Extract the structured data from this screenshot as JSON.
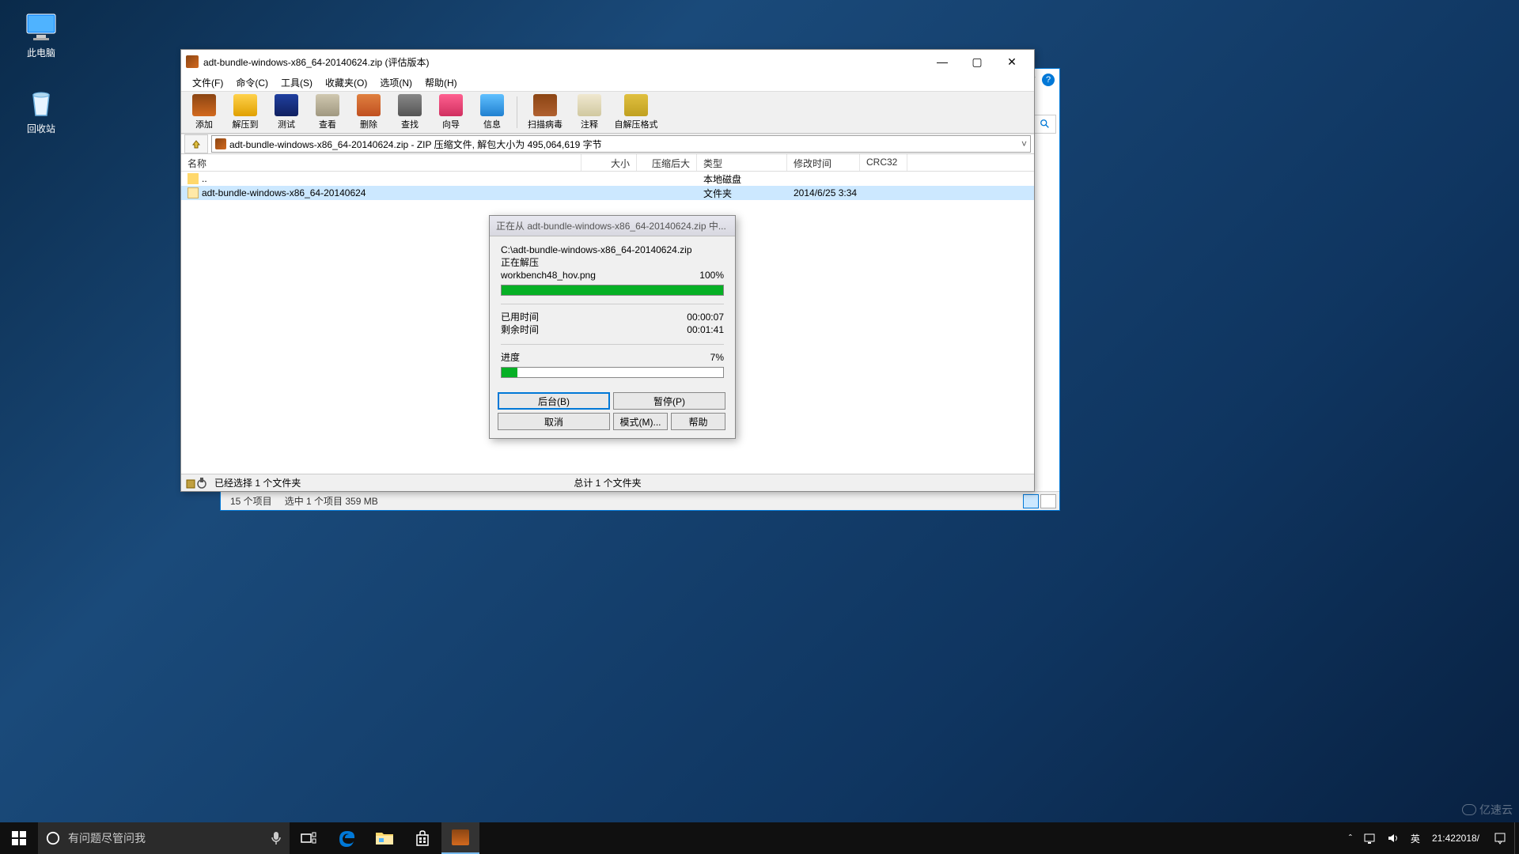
{
  "desktop": {
    "this_pc": "此电脑",
    "recycle_bin": "回收站"
  },
  "winrar": {
    "title": "adt-bundle-windows-x86_64-20140624.zip (评估版本)",
    "menu": {
      "file": "文件(F)",
      "command": "命令(C)",
      "tool": "工具(S)",
      "fav": "收藏夹(O)",
      "opt": "选项(N)",
      "help": "帮助(H)"
    },
    "toolbar": {
      "add": "添加",
      "extract": "解压到",
      "test": "测试",
      "view": "查看",
      "delete": "删除",
      "find": "查找",
      "wizard": "向导",
      "info": "信息",
      "scan": "扫描病毒",
      "comment": "注释",
      "sfx": "自解压格式"
    },
    "address": "adt-bundle-windows-x86_64-20140624.zip - ZIP 压缩文件, 解包大小为 495,064,619 字节",
    "columns": {
      "name": "名称",
      "size": "大小",
      "packed": "压缩后大小",
      "type": "类型",
      "modified": "修改时间",
      "crc": "CRC32"
    },
    "rows": {
      "up": {
        "name": "..",
        "type": "本地磁盘"
      },
      "folder": {
        "name": "adt-bundle-windows-x86_64-20140624",
        "type": "文件夹",
        "modified": "2014/6/25 3:34"
      }
    },
    "status_left": "已经选择 1 个文件夹",
    "status_right": "总计 1 个文件夹"
  },
  "dialog": {
    "title": "正在从 adt-bundle-windows-x86_64-20140624.zip 中...",
    "path": "C:\\adt-bundle-windows-x86_64-20140624.zip",
    "action": "正在解压",
    "file": "workbench48_hov.png",
    "file_pct": "100%",
    "elapsed_label": "已用时间",
    "elapsed": "00:00:07",
    "remain_label": "剩余时间",
    "remain": "00:01:41",
    "progress_label": "进度",
    "progress_pct": "7%",
    "progress_val": 7,
    "btn_bg": "后台(B)",
    "btn_pause": "暂停(P)",
    "btn_cancel": "取消",
    "btn_mode": "模式(M)...",
    "btn_help": "帮助"
  },
  "explorer": {
    "status_items": "15 个项目",
    "status_sel": "选中 1 个项目  359 MB"
  },
  "taskbar": {
    "search_placeholder": "有问题尽管问我",
    "ime": "英",
    "time": "21:42",
    "date": "2018/"
  },
  "watermark": "亿速云"
}
